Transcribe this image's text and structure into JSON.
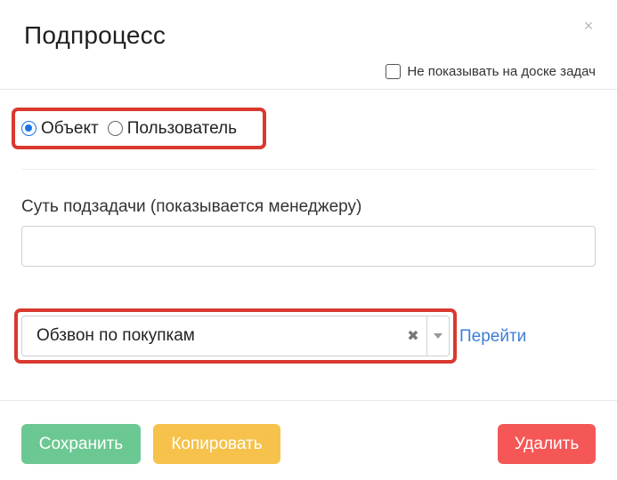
{
  "modal": {
    "title": "Подпроцесс",
    "close_symbol": "×",
    "hide_on_board_label": "Не показывать на доске задач"
  },
  "radio_group": {
    "options": [
      {
        "label": "Объект",
        "checked": true
      },
      {
        "label": "Пользователь",
        "checked": false
      }
    ]
  },
  "subtask": {
    "label": "Суть подзадачи (показывается менеджеру)",
    "value": "",
    "placeholder": ""
  },
  "process_select": {
    "value": "Обзвон по покупкам",
    "clear_symbol": "✖",
    "goto_label": "Перейти"
  },
  "buttons": {
    "save": "Сохранить",
    "copy": "Копировать",
    "delete": "Удалить"
  },
  "colors": {
    "save": "#6cc892",
    "copy": "#f6c24b",
    "delete": "#f55757",
    "link": "#3d7dd8",
    "highlight": "#d9392f",
    "radio_checked": "#1a73e8"
  },
  "icons": {
    "close": "close-icon",
    "clear": "clear-icon",
    "dropdown": "chevron-down-icon"
  }
}
